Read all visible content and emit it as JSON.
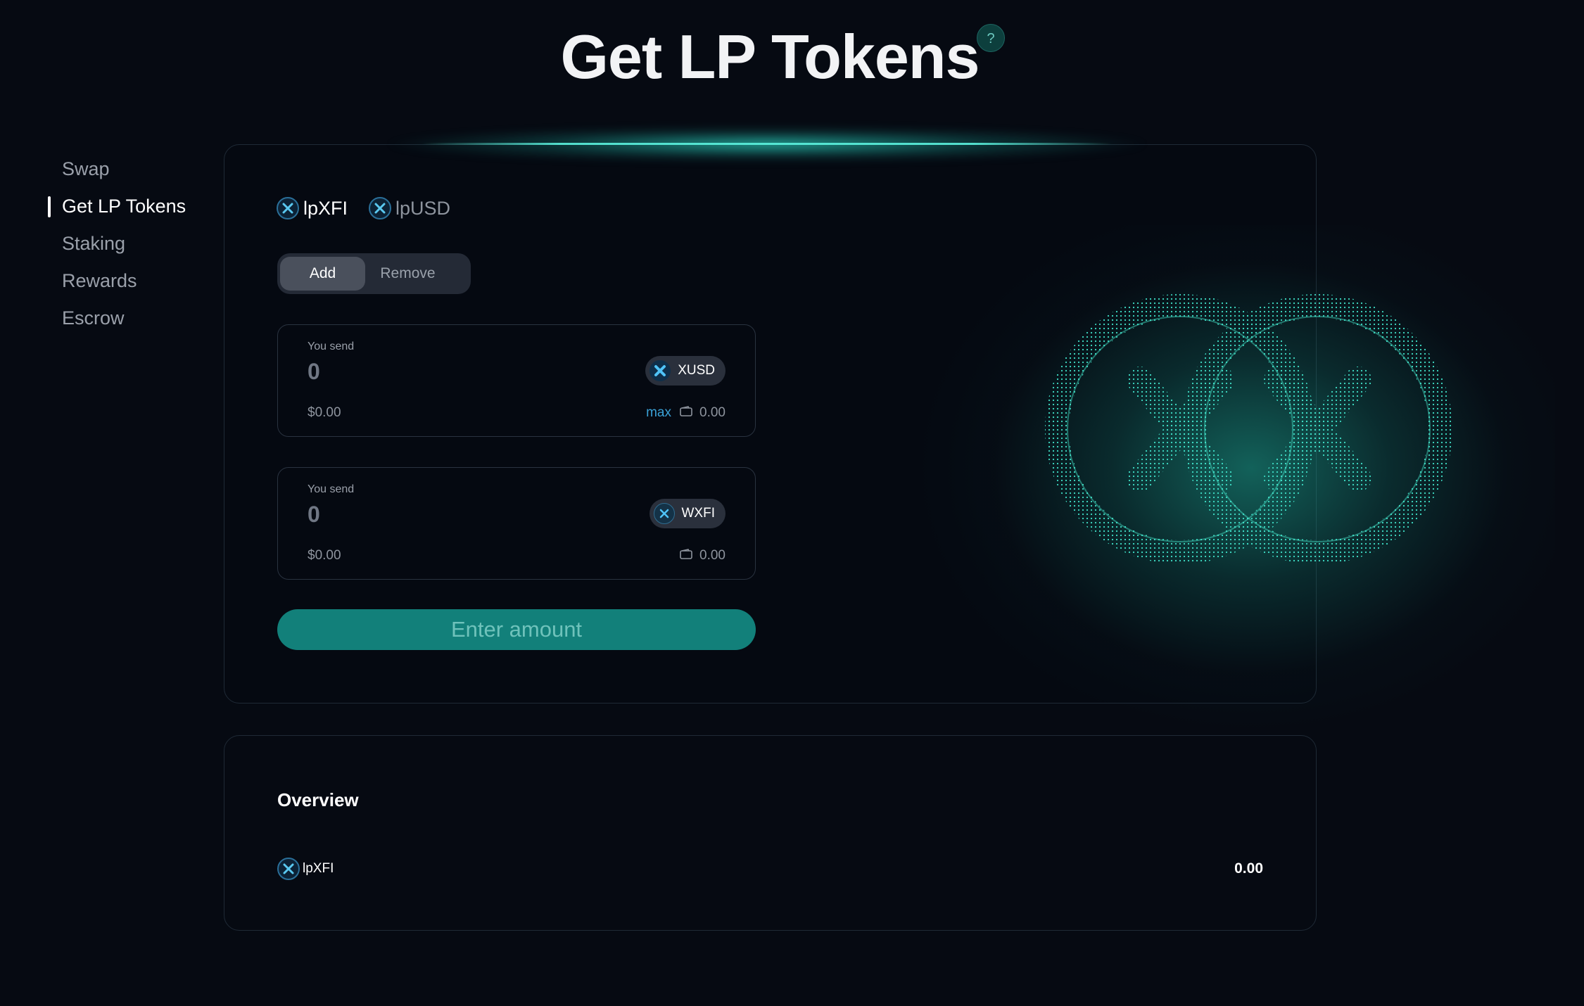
{
  "header": {
    "title": "Get LP Tokens",
    "help_label": "?"
  },
  "nav": {
    "items": [
      "Swap",
      "Get LP Tokens",
      "Staking",
      "Rewards",
      "Escrow"
    ],
    "active": "Get LP Tokens"
  },
  "pool_tabs": [
    {
      "label": "lpXFI",
      "active": true
    },
    {
      "label": "lpUSD",
      "active": false
    }
  ],
  "mode_toggle": {
    "add": "Add",
    "remove": "Remove",
    "active": "Add"
  },
  "inputs": [
    {
      "label": "You send",
      "amount": "0",
      "usd": "$0.00",
      "token": "XUSD",
      "max_label": "max",
      "balance": "0.00",
      "wallet_icon": "wallet-icon",
      "token_icon": "xusd-token-icon"
    },
    {
      "label": "You send",
      "amount": "0",
      "usd": "$0.00",
      "token": "WXFI",
      "balance": "0.00",
      "wallet_icon": "wallet-icon",
      "token_icon": "wxfi-token-icon"
    }
  ],
  "action_button": {
    "label": "Enter amount"
  },
  "overview": {
    "title": "Overview",
    "rows": [
      {
        "token": "lpXFI",
        "value": "0.00"
      }
    ]
  },
  "colors": {
    "background": "#060a12",
    "accent": "#12807a",
    "glow": "#2dd7c3",
    "link": "#3aa1d6"
  }
}
